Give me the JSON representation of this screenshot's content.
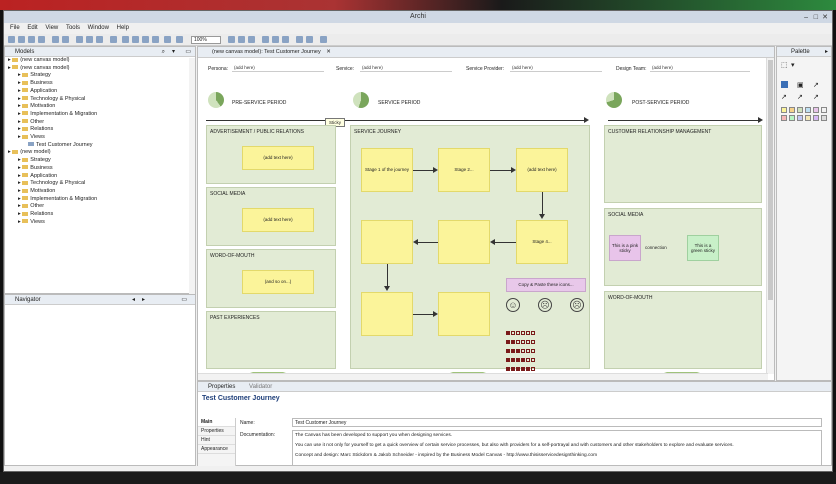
{
  "app": {
    "title": "Archi"
  },
  "menu": [
    "File",
    "Edit",
    "View",
    "Tools",
    "Window",
    "Help"
  ],
  "toolbar": {
    "zoom": "100%"
  },
  "models_panel": {
    "title": "Models",
    "tree": [
      {
        "label": "(new canvas model)",
        "depth": 0
      },
      {
        "label": "(new canvas model)",
        "depth": 0
      },
      {
        "label": "Strategy",
        "depth": 1
      },
      {
        "label": "Business",
        "depth": 1
      },
      {
        "label": "Application",
        "depth": 1
      },
      {
        "label": "Technology & Physical",
        "depth": 1
      },
      {
        "label": "Motivation",
        "depth": 1
      },
      {
        "label": "Implementation & Migration",
        "depth": 1
      },
      {
        "label": "Other",
        "depth": 1
      },
      {
        "label": "Relations",
        "depth": 1
      },
      {
        "label": "Views",
        "depth": 1
      },
      {
        "label": "Test Customer Journey",
        "depth": 2
      },
      {
        "label": "(new model)",
        "depth": 0
      },
      {
        "label": "Strategy",
        "depth": 1
      },
      {
        "label": "Business",
        "depth": 1
      },
      {
        "label": "Application",
        "depth": 1
      },
      {
        "label": "Technology & Physical",
        "depth": 1
      },
      {
        "label": "Motivation",
        "depth": 1
      },
      {
        "label": "Implementation & Migration",
        "depth": 1
      },
      {
        "label": "Other",
        "depth": 1
      },
      {
        "label": "Relations",
        "depth": 1
      },
      {
        "label": "Views",
        "depth": 1
      }
    ]
  },
  "navigator": {
    "title": "Navigator"
  },
  "editor": {
    "tab": "(new canvas model): Test Customer Journey",
    "fields": {
      "persona_label": "Persona:",
      "persona_value": "(add here)",
      "service_label": "Service:",
      "service_value": "(add here)",
      "provider_label": "Service Provider:",
      "provider_value": "(add here)",
      "team_label": "Design Team:",
      "team_value": "(add here)"
    },
    "phases": {
      "pre": "PRE-SERVICE PERIOD",
      "service": "SERVICE PERIOD",
      "post": "POST-SERVICE PERIOD"
    },
    "tooltip": "Sticky",
    "left_sections": [
      "ADVERTISEMENT / PUBLIC RELATIONS",
      "SOCIAL MEDIA",
      "WORD-OF-MOUTH",
      "PAST EXPERIENCES"
    ],
    "left_stickies": [
      "(add text here)",
      "(add text here)",
      "(and so on...)"
    ],
    "journey": {
      "title": "SERVICE JOURNEY",
      "stickies": [
        "Stage 1 of the journey",
        "Stage 2...",
        "(add text here)",
        "Stage 4..."
      ],
      "copy_note": "Copy & Paste these icons..."
    },
    "right_sections": [
      "CUSTOMER RELATIONSHIP MANAGEMENT",
      "SOCIAL MEDIA",
      "WORD-OF-MOUTH"
    ],
    "right_stickies": {
      "pink": "This is a pink sticky",
      "connection": "connection",
      "green": "This is a green sticky"
    }
  },
  "palette": {
    "title": "Palette"
  },
  "properties": {
    "tab": "Properties",
    "tab2": "Validator",
    "title": "Test Customer Journey",
    "sections": [
      "Main",
      "Properties",
      "Hint",
      "Appearance"
    ],
    "name_label": "Name:",
    "name_value": "Test Customer Journey",
    "doc_label": "Documentation:",
    "doc_lines": [
      "The Canvas has been developed to support you when designing services.",
      "You can use it not only for yourself to get a quick overview of certain service processes, but also with providers for a self-portrayal and with customers and other stakeholders to explore and evaluate services.",
      "Concept and design: Marc Stickdorn & Jakob Schneider - inspired by the Business Model Canvas - http://www.thisisservicedesignthinking.com"
    ]
  }
}
